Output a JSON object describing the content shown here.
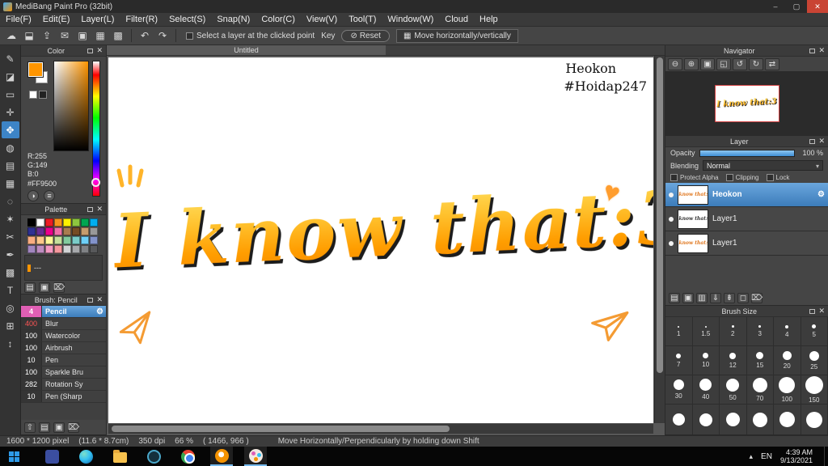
{
  "titlebar": {
    "title": "MediBang Paint Pro (32bit)"
  },
  "menubar": {
    "items": [
      "File(F)",
      "Edit(E)",
      "Layer(L)",
      "Filter(R)",
      "Select(S)",
      "Snap(N)",
      "Color(C)",
      "View(V)",
      "Tool(T)",
      "Window(W)",
      "Cloud",
      "Help"
    ]
  },
  "toolbar": {
    "icons": [
      {
        "name": "cloud-icon",
        "glyph": "☁"
      },
      {
        "name": "save-icon",
        "glyph": "⬓"
      },
      {
        "name": "publish-icon",
        "glyph": "⇪"
      },
      {
        "name": "comment-icon",
        "glyph": "✉"
      },
      {
        "name": "copy-icon",
        "glyph": "▣"
      },
      {
        "name": "grid-icon",
        "glyph": "▦"
      },
      {
        "name": "material-panel-icon",
        "glyph": "▩"
      }
    ],
    "undo_glyph": "↶",
    "redo_glyph": "↷",
    "select_layer_label": "Select a layer at the clicked point",
    "key_label": "Key",
    "reset_glyph": "⊘",
    "reset_label": "Reset",
    "move_glyph": "▦",
    "move_label": "Move horizontally/vertically"
  },
  "tools": [
    {
      "name": "pen-tool",
      "glyph": "✎"
    },
    {
      "name": "eraser-tool",
      "glyph": "◪"
    },
    {
      "name": "figure-tool",
      "glyph": "▭"
    },
    {
      "name": "eyedropper-tool",
      "glyph": "✛"
    },
    {
      "name": "move-tool",
      "glyph": "✥",
      "selected": true
    },
    {
      "name": "bucket-tool",
      "glyph": "◍"
    },
    {
      "name": "gradient-tool",
      "glyph": "▤"
    },
    {
      "name": "select-rect-tool",
      "glyph": "▦"
    },
    {
      "name": "lasso-tool",
      "glyph": "◌"
    },
    {
      "name": "magic-wand-tool",
      "glyph": "✶"
    },
    {
      "name": "divide-tool",
      "glyph": "✂"
    },
    {
      "name": "control-point-tool",
      "glyph": "✒"
    },
    {
      "name": "mesh-tool",
      "glyph": "▩"
    },
    {
      "name": "text-tool",
      "glyph": "T"
    },
    {
      "name": "zoom-tool",
      "glyph": "◎"
    },
    {
      "name": "grid-snap-tool",
      "glyph": "⊞"
    },
    {
      "name": "hand-tool",
      "glyph": "↕"
    }
  ],
  "color_panel": {
    "title": "Color",
    "fg_color": "#FF9500",
    "r": "R:255",
    "g": "G:149",
    "b": "B:0",
    "hex": "#FF9500",
    "buttons": [
      {
        "name": "color-wheel-icon",
        "glyph": "◑"
      },
      {
        "name": "slider-mode-icon",
        "glyph": "≡"
      }
    ]
  },
  "palette_panel": {
    "title": "Palette",
    "swatches": [
      "#000000",
      "#ffffff",
      "#ed1c24",
      "#f7941d",
      "#fff200",
      "#8dc63f",
      "#00a651",
      "#00aeef",
      "#2e3192",
      "#662d91",
      "#ec008c",
      "#f06eaa",
      "#a97c50",
      "#754c24",
      "#c69c6d",
      "#999999",
      "#f9ad81",
      "#fdc68a",
      "#fff799",
      "#c4df9b",
      "#82ca9d",
      "#7accc8",
      "#6ecff6",
      "#8393ca",
      "#a186be",
      "#bd8cbf",
      "#f49ac2",
      "#f5989d",
      "#d1d3d4",
      "#a7a9ac",
      "#808285",
      "#58595b"
    ],
    "list_item": "---",
    "footer_icons": [
      {
        "name": "add-color-icon",
        "glyph": "▤"
      },
      {
        "name": "edit-color-icon",
        "glyph": "▣"
      },
      {
        "name": "delete-color-icon",
        "glyph": "⌦"
      }
    ]
  },
  "brush_panel": {
    "title": "Brush: Pencil",
    "items": [
      {
        "size": "4",
        "name": "Pencil",
        "num_color": "#ffffff",
        "selected": true
      },
      {
        "size": "400",
        "name": "Blur",
        "num_color": "#ff5555"
      },
      {
        "size": "100",
        "name": "Watercolor",
        "num_color": "#ffffff"
      },
      {
        "size": "100",
        "name": "Airbrush",
        "num_color": "#ffffff"
      },
      {
        "size": "10",
        "name": "Pen",
        "num_color": "#ffffff"
      },
      {
        "size": "100",
        "name": "Sparkle Bru",
        "num_color": "#ffffff"
      },
      {
        "size": "282",
        "name": "Rotation Sy",
        "num_color": "#ffffff"
      },
      {
        "size": "10",
        "name": "Pen (Sharp",
        "num_color": "#ffffff"
      }
    ],
    "footer_icons": [
      {
        "name": "upload-brush-icon",
        "glyph": "⇧"
      },
      {
        "name": "new-brush-icon",
        "glyph": "▤"
      },
      {
        "name": "edit-brush-icon",
        "glyph": "▣"
      },
      {
        "name": "delete-brush-icon",
        "glyph": "⌦"
      }
    ]
  },
  "navigator_panel": {
    "title": "Navigator",
    "buttons": [
      {
        "name": "zoom-out-icon",
        "glyph": "⊖"
      },
      {
        "name": "zoom-in-icon",
        "glyph": "⊕"
      },
      {
        "name": "fit-window-icon",
        "glyph": "▣"
      },
      {
        "name": "actual-pixels-icon",
        "glyph": "◱"
      },
      {
        "name": "rotate-ccw-icon",
        "glyph": "↺"
      },
      {
        "name": "rotate-cw-icon",
        "glyph": "↻"
      },
      {
        "name": "reset-view-icon",
        "glyph": "⇄"
      }
    ]
  },
  "layer_panel": {
    "title": "Layer",
    "opacity_label": "Opacity",
    "opacity_value": "100 %",
    "blending_label": "Blending",
    "blending_value": "Normal",
    "protect_alpha_label": "Protect Alpha",
    "clipping_label": "Clipping",
    "lock_label": "Lock",
    "layers": [
      {
        "name": "Heokon",
        "selected": true
      },
      {
        "name": "Layer1"
      },
      {
        "name": "Layer1"
      }
    ],
    "footer_icons": [
      {
        "name": "new-layer-icon",
        "glyph": "▤"
      },
      {
        "name": "duplicate-layer-icon",
        "glyph": "▣"
      },
      {
        "name": "new-folder-icon",
        "glyph": "▥"
      },
      {
        "name": "transfer-icon",
        "glyph": "⇓"
      },
      {
        "name": "merge-icon",
        "glyph": "⇟"
      },
      {
        "name": "clear-layer-icon",
        "glyph": "◻"
      },
      {
        "name": "delete-layer-icon",
        "glyph": "⌦"
      }
    ]
  },
  "brush_size_panel": {
    "title": "Brush Size",
    "sizes": [
      {
        "label": "1",
        "dot": 2
      },
      {
        "label": "1.5",
        "dot": 2
      },
      {
        "label": "2",
        "dot": 3
      },
      {
        "label": "3",
        "dot": 3
      },
      {
        "label": "4",
        "dot": 4
      },
      {
        "label": "5",
        "dot": 5
      },
      {
        "label": "7",
        "dot": 6
      },
      {
        "label": "10",
        "dot": 7
      },
      {
        "label": "12",
        "dot": 8
      },
      {
        "label": "15",
        "dot": 9
      },
      {
        "label": "20",
        "dot": 11
      },
      {
        "label": "25",
        "dot": 12
      },
      {
        "label": "30",
        "dot": 13
      },
      {
        "label": "40",
        "dot": 15
      },
      {
        "label": "50",
        "dot": 16
      },
      {
        "label": "70",
        "dot": 18
      },
      {
        "label": "100",
        "dot": 20
      },
      {
        "label": "150",
        "dot": 22
      }
    ]
  },
  "canvas": {
    "tab": "Untitled",
    "signature_line1": "Heokon",
    "signature_line2": "#Hoidap247",
    "art_text": "I know that:3"
  },
  "statusbar": {
    "size": "1600 * 1200 pixel",
    "cm": "(11.6 * 8.7cm)",
    "dpi": "350 dpi",
    "zoom": "66 %",
    "coords": "( 1466, 966 )",
    "hint": "Move Horizontally/Perpendicularly by holding down Shift"
  },
  "taskbar": {
    "language": "EN",
    "time": "4:39 AM",
    "date": "9/13/2021"
  }
}
